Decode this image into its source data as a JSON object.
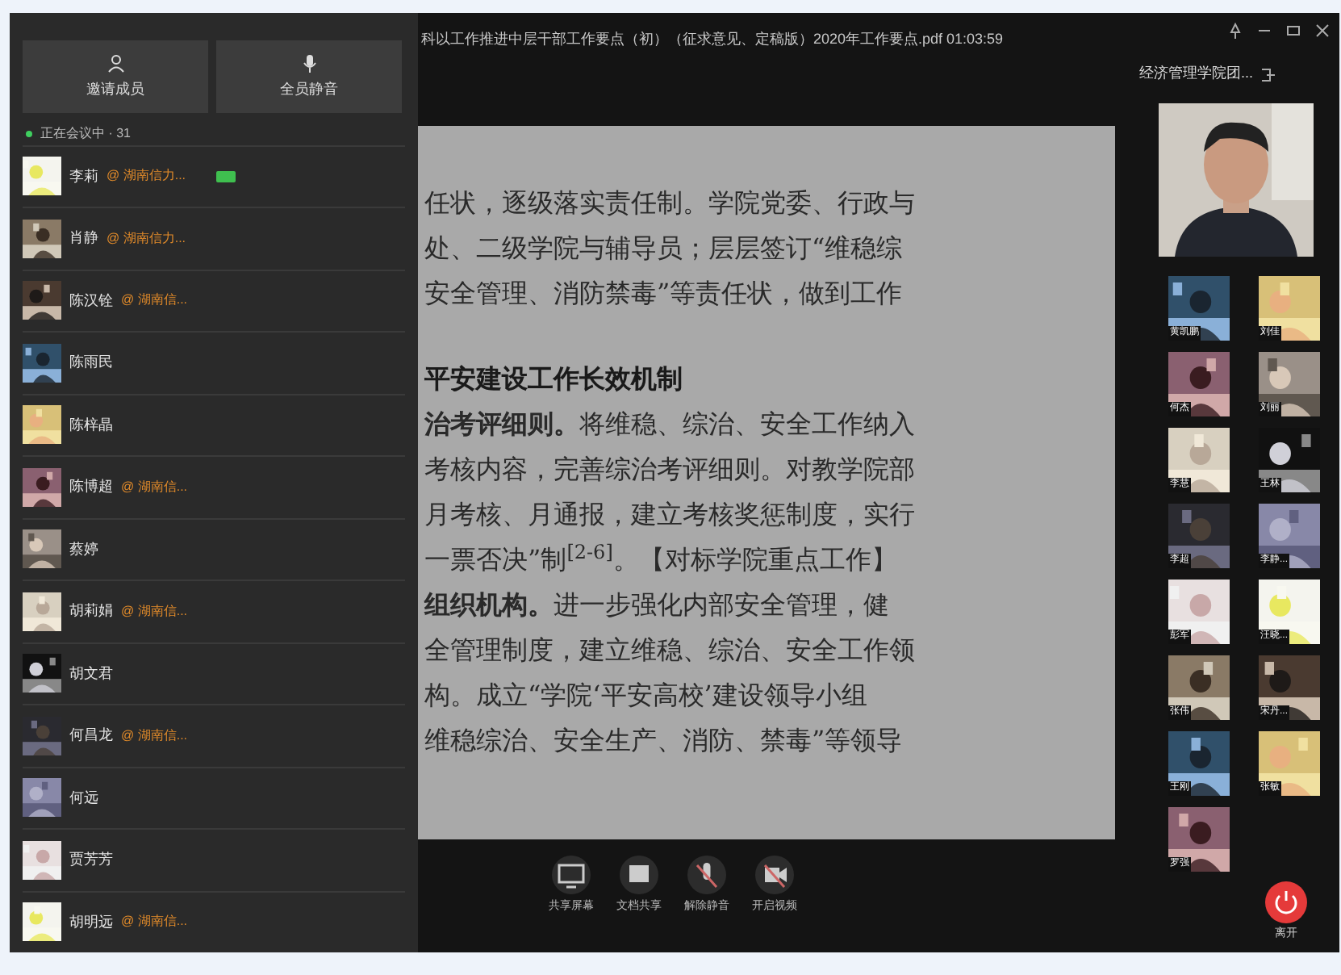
{
  "window": {
    "title": "科以工作推进中层干部工作要点（初）（征求意见、定稿版）2020年工作要点.pdf 01:03:59"
  },
  "sidebar": {
    "buttons": [
      "邀请成员",
      "全员静音"
    ],
    "member_count": "正在会议中 · 31",
    "members": [
      {
        "name": "李莉",
        "status": "@ 湖南信力...",
        "video_on": true
      },
      {
        "name": "肖静",
        "status": "@ 湖南信力...",
        "video_on": false
      },
      {
        "name": "陈汉铨",
        "status": "@ 湖南信...",
        "video_on": false
      },
      {
        "name": "陈雨民",
        "video_on": false
      },
      {
        "name": "陈梓晶",
        "video_on": false
      },
      {
        "name": "陈博超",
        "status": "@ 湖南信...",
        "video_on": false
      },
      {
        "name": "蔡婷",
        "video_on": false
      },
      {
        "name": "胡莉娟",
        "status": "@ 湖南信...",
        "video_on": false
      },
      {
        "name": "胡文君",
        "video_on": false
      },
      {
        "name": "何昌龙",
        "status": "@ 湖南信...",
        "video_on": false
      },
      {
        "name": "何远",
        "video_on": false
      },
      {
        "name": "贾芳芳",
        "video_on": false
      },
      {
        "name": "胡明远",
        "status": "@ 湖南信...",
        "video_on": false
      }
    ]
  },
  "document": {
    "lines": [
      {
        "kind": "text",
        "text": "任状，逐级落实责任制。学院党委、行政与"
      },
      {
        "kind": "text",
        "text": "处、二级学院与辅导员；层层签订“维稳综"
      },
      {
        "kind": "text",
        "text": "安全管理、消防禁毒”等责任状，做到工作"
      },
      {
        "kind": "gap"
      },
      {
        "kind": "heading",
        "text": "平安建设工作长效机制"
      },
      {
        "kind": "text",
        "text": "**治考评细则。**将维稳、综治、安全工作纳入"
      },
      {
        "kind": "text",
        "text": "考核内容，完善综治考评细则。对教学院部"
      },
      {
        "kind": "text",
        "text": "月考核、月通报，建立考核奖惩制度，实行"
      },
      {
        "kind": "text",
        "text": "一票否决”制$^{[2-6]}$。【对标学院重点工作】"
      },
      {
        "kind": "text",
        "text": "**组织机构。**进一步强化内部安全管理，健"
      },
      {
        "kind": "text",
        "text": "全管理制度，建立维稳、综治、安全工作领"
      },
      {
        "kind": "text",
        "text": "构。成立“学院‘平安高校’建设领导小组"
      },
      {
        "kind": "text",
        "text": "维稳综治、安全生产、消防、禁毒”等领导"
      }
    ]
  },
  "toolbar": [
    "共享屏幕",
    "文档共享",
    "解除静音",
    "开启视频"
  ],
  "video_panel": {
    "title": "经济管理学院团...",
    "thumbnails": [
      "黄凯鹏",
      "刘佳",
      "何杰",
      "刘丽",
      "李慧",
      "王林",
      "李超",
      "李静...",
      "彭军",
      "汪晓...",
      "张伟",
      "宋丹...",
      "王刚",
      "张敏",
      "罗强"
    ],
    "leave": "离开"
  }
}
